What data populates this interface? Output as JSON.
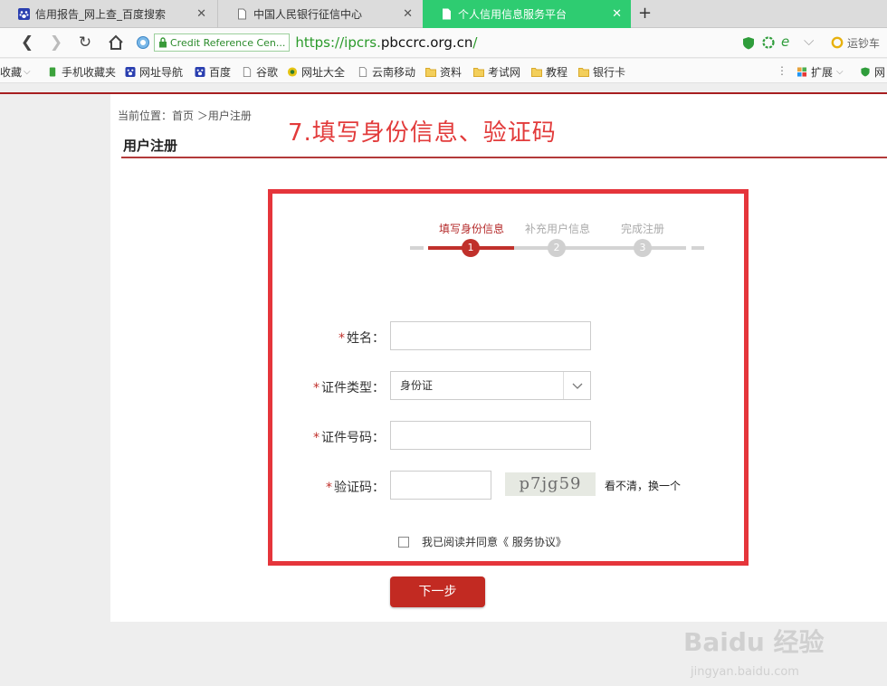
{
  "browser": {
    "tabs": [
      {
        "label": "信用报告_网上查_百度搜索",
        "icon": "paw-icon"
      },
      {
        "label": "中国人民银行征信中心",
        "icon": "page-icon"
      },
      {
        "label": "个人信用信息服务平台",
        "icon": "page-icon"
      }
    ],
    "new_tab": "+",
    "address": {
      "cert_label": "Credit Reference Cen...",
      "url_prefix": "https://ipcrs.",
      "url_domain": "pbccrc.org.cn",
      "url_suffix": "/",
      "right_text": "运钞车"
    },
    "bookmarks": [
      {
        "label": "收藏",
        "icon": "chevron-down-icon"
      },
      {
        "label": "手机收藏夹",
        "icon": "phone-icon"
      },
      {
        "label": "网址导航",
        "icon": "paw-icon"
      },
      {
        "label": "百度",
        "icon": "paw-icon"
      },
      {
        "label": "谷歌",
        "icon": "page-icon"
      },
      {
        "label": "网址大全",
        "icon": "globe-icon"
      },
      {
        "label": "云南移动",
        "icon": "page-icon"
      },
      {
        "label": "资料",
        "icon": "folder-icon"
      },
      {
        "label": "考试网",
        "icon": "folder-icon"
      },
      {
        "label": "教程",
        "icon": "folder-icon"
      },
      {
        "label": "银行卡",
        "icon": "folder-icon"
      },
      {
        "label": "扩展",
        "icon": "extension-icon"
      },
      {
        "label": "网",
        "icon": "shield-icon"
      }
    ]
  },
  "page": {
    "breadcrumb": "当前位置：首页 ＞用户注册",
    "annotation": "7.填写身份信息、验证码",
    "title": "用户注册",
    "steps": [
      {
        "number": "1",
        "label": "填写身份信息",
        "state": "active"
      },
      {
        "number": "2",
        "label": "补充用户信息",
        "state": "inactive"
      },
      {
        "number": "3",
        "label": "完成注册",
        "state": "inactive"
      }
    ],
    "form": {
      "required_mark": "*",
      "name_label": "姓名：",
      "name_value": "",
      "idtype_label": "证件类型：",
      "idtype_value": "身份证",
      "idnumber_label": "证件号码：",
      "idnumber_value": "",
      "captcha_label": "验证码：",
      "captcha_value": "",
      "captcha_image_text": "p7jg59",
      "captcha_refresh": "看不清，换一个",
      "agree_text": "我已阅读并同意《  服务协议》",
      "next_button": "下一步"
    }
  },
  "watermark": {
    "brand": "Baidu 经验",
    "url": "jingyan.baidu.com"
  },
  "colors": {
    "accent_red": "#c0302b",
    "annotation_red": "#e23b3b",
    "active_tab_green": "#2ecc71",
    "url_green": "#2a9a2a"
  }
}
